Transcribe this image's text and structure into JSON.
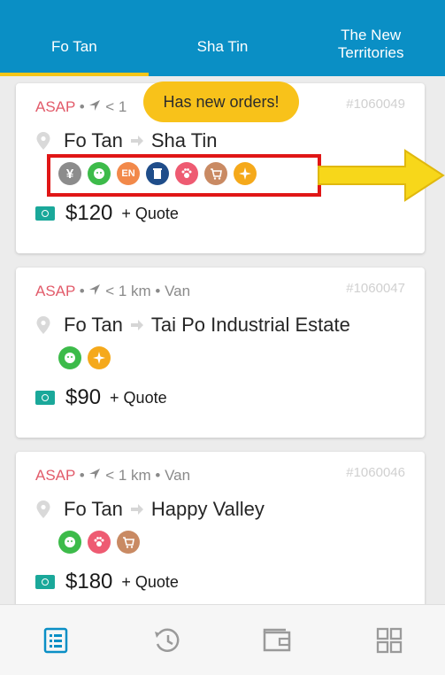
{
  "tabs": [
    {
      "label": "Fo Tan",
      "active": true
    },
    {
      "label": "Sha Tin",
      "active": false
    },
    {
      "label": "The New Territories",
      "active": false
    }
  ],
  "banner": "Has new orders!",
  "orders": [
    {
      "asap": "ASAP",
      "meta_tail": "< 1",
      "order_no": "#1060049",
      "from": "Fo Tan",
      "to": "Sha Tin",
      "price": "$120",
      "quote": "+ Quote",
      "service_icons": [
        "cash-icon",
        "pet-icon-green",
        "english-icon",
        "clearance-icon",
        "pet-paw-icon",
        "cart-icon",
        "sparkle-icon"
      ]
    },
    {
      "asap": "ASAP",
      "meta_tail": "< 1 km • Van",
      "order_no": "#1060047",
      "from": "Fo Tan",
      "to": "Tai Po Industrial Estate",
      "price": "$90",
      "quote": "+ Quote",
      "service_icons": [
        "pet-icon-green",
        "sparkle-icon"
      ]
    },
    {
      "asap": "ASAP",
      "meta_tail": "< 1 km • Van",
      "order_no": "#1060046",
      "from": "Fo Tan",
      "to": "Happy Valley",
      "price": "$180",
      "quote": "+ Quote",
      "service_icons": [
        "pet-icon-green",
        "pet-paw-icon",
        "cart-icon"
      ]
    }
  ],
  "icon_labels": {
    "cash": "¥",
    "english": "EN"
  },
  "colors": {
    "tab_bar": "#0a8fc5",
    "tab_indicator": "#f5c518",
    "asap": "#e25b6a",
    "highlight_box": "#e01616",
    "banner": "#f8c21a",
    "money_icon": "#1aa89a",
    "nav_active": "#0a8fc5"
  },
  "bottom_nav": [
    {
      "name": "orders-list-icon",
      "active": true
    },
    {
      "name": "history-icon",
      "active": false
    },
    {
      "name": "wallet-icon",
      "active": false
    },
    {
      "name": "grid-menu-icon",
      "active": false
    }
  ]
}
